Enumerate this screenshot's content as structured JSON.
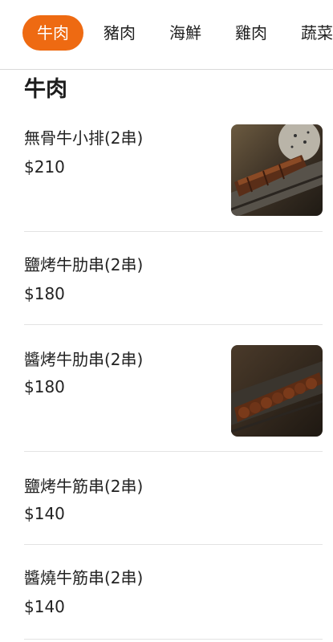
{
  "category_tabs": [
    {
      "label": "牛肉",
      "active": true
    },
    {
      "label": "豬肉",
      "active": false
    },
    {
      "label": "海鮮",
      "active": false
    },
    {
      "label": "雞肉",
      "active": false
    },
    {
      "label": "蔬菜",
      "active": false
    }
  ],
  "section": {
    "title": "牛肉"
  },
  "menu_items": [
    {
      "name": "無骨牛小排(2串)",
      "price": "$210"
    },
    {
      "name": "鹽烤牛肋串(2串)",
      "price": "$180"
    },
    {
      "name": "醬烤牛肋串(2串)",
      "price": "$180"
    },
    {
      "name": "鹽烤牛筋串(2串)",
      "price": "$140"
    },
    {
      "name": "醬燒牛筋串(2串)",
      "price": "$140"
    }
  ],
  "colors": {
    "accent": "#ee6a12"
  }
}
